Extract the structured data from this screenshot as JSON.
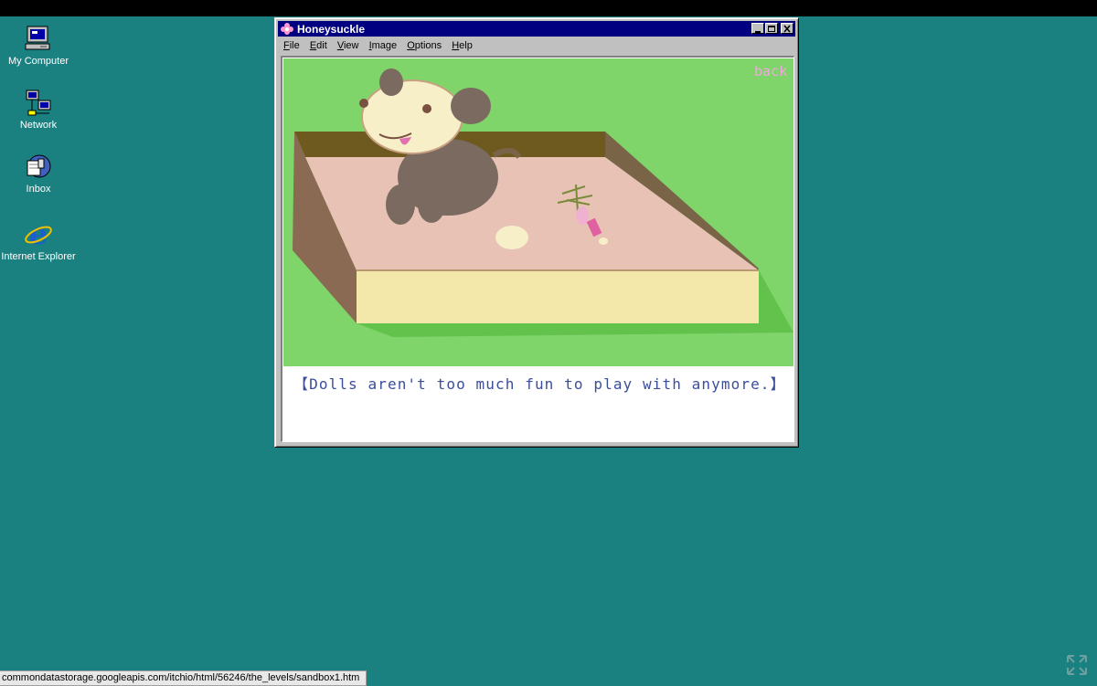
{
  "desktop": {
    "icons": [
      {
        "label": "My Computer",
        "icon": "my-computer-icon"
      },
      {
        "label": "Network",
        "icon": "network-icon"
      },
      {
        "label": "Inbox",
        "icon": "inbox-icon"
      },
      {
        "label": "Internet Explorer",
        "icon": "internet-explorer-icon"
      }
    ]
  },
  "window": {
    "title": "Honeysuckle",
    "menu": [
      "File",
      "Edit",
      "View",
      "Image",
      "Options",
      "Help"
    ],
    "back_link": "back",
    "dialogue": "【Dolls aren't too much fun to play with anymore.】"
  },
  "statusbar": {
    "url": "commondatastorage.googleapis.com/itchio/html/56246/the_levels/sandbox1.htm"
  },
  "colors": {
    "desktop": "#1b8080",
    "titlebar": "#000080",
    "grass": "#7fd46a",
    "sand": "#e8c3b5",
    "dialogue_text": "#3a4e9a",
    "back_link": "#f0a8e0"
  }
}
